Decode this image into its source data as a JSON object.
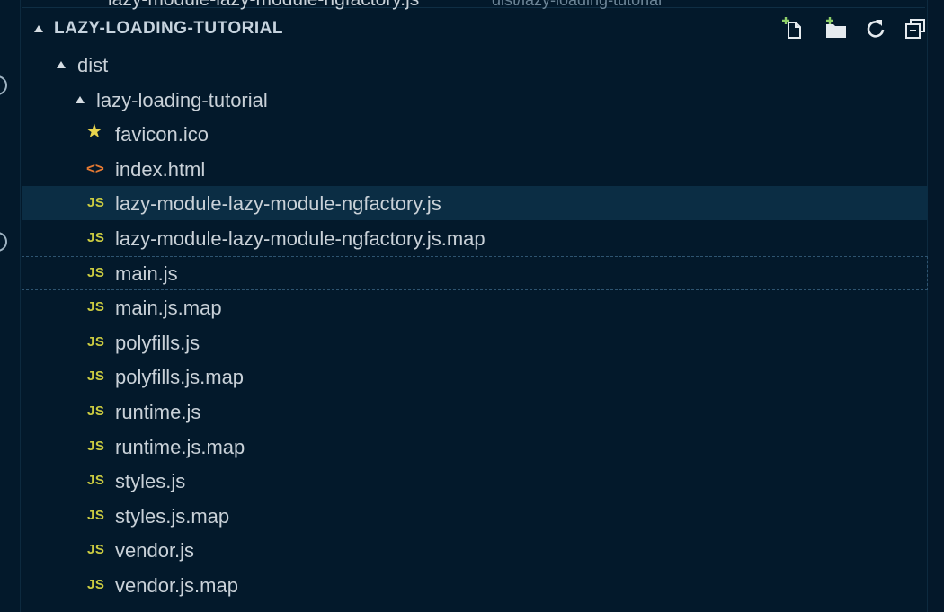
{
  "top_cut_row": {
    "name": "lazy-module-lazy-module-ngfactory.js",
    "path": "dist/lazy-loading-tutorial"
  },
  "explorer": {
    "section_title": "LAZY-LOADING-TUTORIAL",
    "actions": [
      {
        "icon": "new-file-icon"
      },
      {
        "icon": "new-folder-icon"
      },
      {
        "icon": "refresh-icon"
      },
      {
        "icon": "collapse-all-icon"
      }
    ],
    "folders": [
      {
        "label": "dist"
      },
      {
        "label": "lazy-loading-tutorial"
      }
    ],
    "files": [
      {
        "label": "favicon.ico",
        "icon": "star-icon"
      },
      {
        "label": "index.html",
        "icon": "html-icon"
      },
      {
        "label": "lazy-module-lazy-module-ngfactory.js",
        "icon": "js-icon",
        "selected": true
      },
      {
        "label": "lazy-module-lazy-module-ngfactory.js.map",
        "icon": "js-icon"
      },
      {
        "label": "main.js",
        "icon": "js-icon",
        "focused": true
      },
      {
        "label": "main.js.map",
        "icon": "js-icon"
      },
      {
        "label": "polyfills.js",
        "icon": "js-icon"
      },
      {
        "label": "polyfills.js.map",
        "icon": "js-icon"
      },
      {
        "label": "runtime.js",
        "icon": "js-icon"
      },
      {
        "label": "runtime.js.map",
        "icon": "js-icon"
      },
      {
        "label": "styles.js",
        "icon": "js-icon"
      },
      {
        "label": "styles.js.map",
        "icon": "js-icon"
      },
      {
        "label": "vendor.js",
        "icon": "js-icon"
      },
      {
        "label": "vendor.js.map",
        "icon": "js-icon"
      }
    ],
    "js_badge": "JS",
    "html_badge": "<>",
    "star_badge": "★"
  },
  "colors": {
    "background": "#03192b",
    "selected_row": "#0b2d44",
    "js_icon": "#cbcb41",
    "html_icon": "#e37933",
    "star_icon": "#e8d44d"
  }
}
